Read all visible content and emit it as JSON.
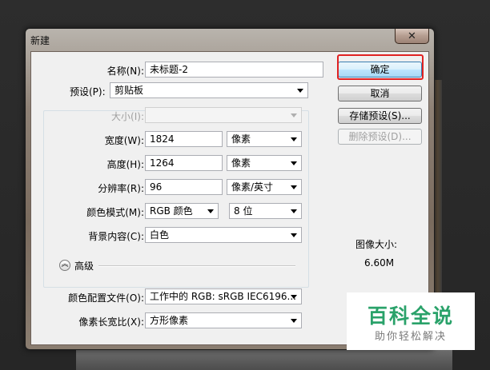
{
  "dialog": {
    "title": "新建",
    "close_label": "✕"
  },
  "form": {
    "name": {
      "label": "名称(N):",
      "value": "未标题-2"
    },
    "preset": {
      "label": "预设(P):",
      "value": "剪贴板"
    },
    "size": {
      "label": "大小(I):",
      "value": ""
    },
    "width": {
      "label": "宽度(W):",
      "value": "1824",
      "unit": "像素"
    },
    "height": {
      "label": "高度(H):",
      "value": "1264",
      "unit": "像素"
    },
    "resolution": {
      "label": "分辨率(R):",
      "value": "96",
      "unit": "像素/英寸"
    },
    "color_mode": {
      "label": "颜色模式(M):",
      "value": "RGB 颜色",
      "depth": "8 位"
    },
    "background": {
      "label": "背景内容(C):",
      "value": "白色"
    },
    "advanced": {
      "label": "高级"
    },
    "color_profile": {
      "label": "颜色配置文件(O):",
      "value": "工作中的 RGB: sRGB IEC6196..."
    },
    "pixel_aspect": {
      "label": "像素长宽比(X):",
      "value": "方形像素"
    }
  },
  "buttons": {
    "ok": "确定",
    "cancel": "取消",
    "save_preset": "存储预设(S)...",
    "delete_preset": "删除预设(D)..."
  },
  "image_size": {
    "label": "图像大小:",
    "value": "6.60M"
  },
  "watermark": {
    "title": "百科全说",
    "subtitle": "助你轻松解决"
  },
  "colors": {
    "highlight": "#e02222",
    "watermark_green": "#2aa26a"
  }
}
